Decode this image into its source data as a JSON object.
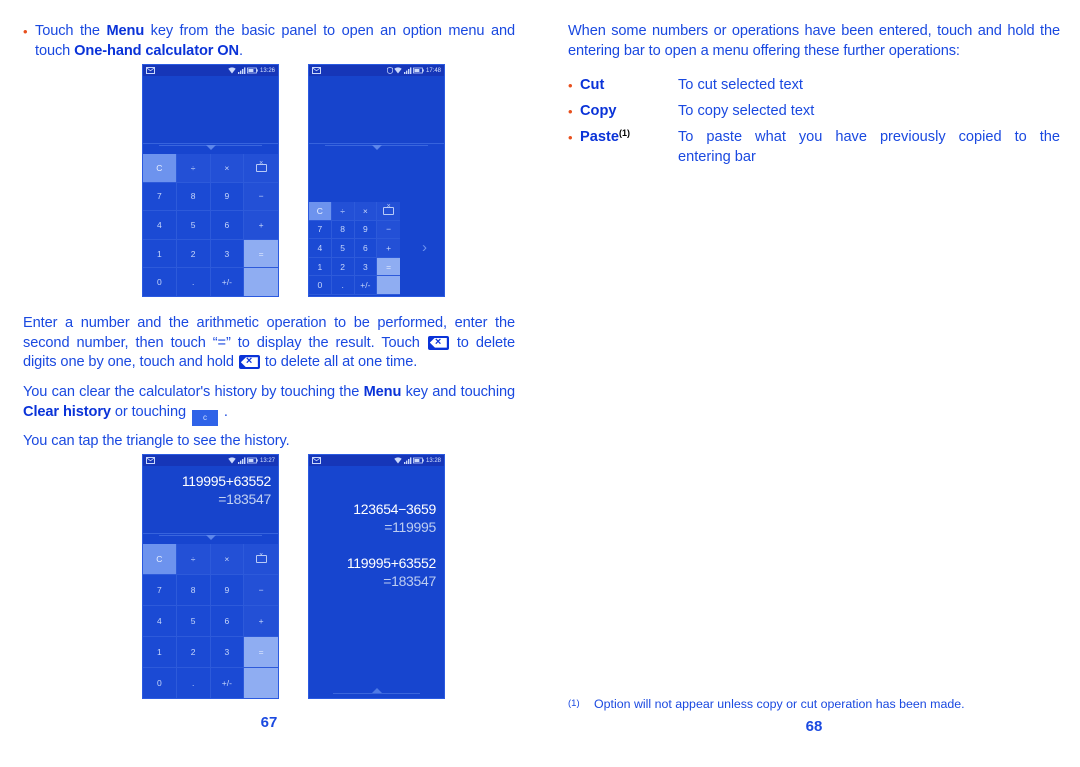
{
  "left_column": {
    "intro_bullet": {
      "bullet": "•",
      "segments": [
        {
          "t": "Touch the ",
          "b": false
        },
        {
          "t": "Menu",
          "b": true
        },
        {
          "t": " key from the basic panel to open an option menu and touch ",
          "b": false
        },
        {
          "t": "One-hand calculator ON",
          "b": true
        },
        {
          "t": ".",
          "b": false
        }
      ]
    },
    "para_enter": {
      "part1": "Enter a number and the arithmetic operation to be performed, enter the second number, then touch “=” to display the result. Touch ",
      "part2": " to delete digits one by one, touch and hold ",
      "part3": " to delete all at one time."
    },
    "para_clear": {
      "part1": "You can clear the calculator's history by touching the ",
      "menu": "Menu",
      "part2": " key and touching ",
      "clear_history": "Clear history",
      "part3": " or touching ",
      "key_c_label": "c",
      "part4": " ."
    },
    "para_triangle": "You can tap the triangle to see the history.",
    "page_number": "67"
  },
  "right_column": {
    "para_when": "When some numbers or operations have been entered, touch and hold the entering bar to open a menu offering these further operations:",
    "operations": [
      {
        "bullet": "•",
        "term": "Cut",
        "sup": "",
        "desc_lines": [
          "To cut selected text"
        ]
      },
      {
        "bullet": "•",
        "term": "Copy",
        "sup": "",
        "desc_lines": [
          "To copy selected text"
        ]
      },
      {
        "bullet": "•",
        "term": "Paste",
        "sup": "(1)",
        "desc_lines": [
          "To paste what you have previously copied to the",
          "entering bar"
        ]
      }
    ],
    "footnote": {
      "mark": "(1)",
      "text": "Option will not appear unless copy or cut operation has been made."
    },
    "page_number": "68"
  },
  "phones": {
    "phone1": {
      "statusbar": {
        "time": "13:26",
        "left_icon": "message-icon",
        "right_icons": [
          "wifi-icon",
          "signal-icon",
          "battery-icon"
        ]
      },
      "display": {
        "expression": "",
        "result": ""
      },
      "keypad": {
        "rows": [
          [
            {
              "l": "C",
              "s": "lite"
            },
            {
              "l": "÷",
              "s": "op"
            },
            {
              "l": "×",
              "s": "op"
            },
            {
              "l": "del",
              "s": "op"
            }
          ],
          [
            {
              "l": "7",
              "s": ""
            },
            {
              "l": "8",
              "s": ""
            },
            {
              "l": "9",
              "s": ""
            },
            {
              "l": "−",
              "s": "op"
            }
          ],
          [
            {
              "l": "4",
              "s": ""
            },
            {
              "l": "5",
              "s": ""
            },
            {
              "l": "6",
              "s": ""
            },
            {
              "l": "+",
              "s": "op"
            }
          ],
          [
            {
              "l": "1",
              "s": ""
            },
            {
              "l": "2",
              "s": ""
            },
            {
              "l": "3",
              "s": ""
            },
            {
              "l": "=",
              "s": "eq"
            }
          ],
          [
            {
              "l": "0",
              "s": ""
            },
            {
              "l": ".",
              "s": ""
            },
            {
              "l": "+/-",
              "s": ""
            },
            {
              "l": "",
              "s": "eq"
            }
          ]
        ]
      }
    },
    "phone2": {
      "statusbar": {
        "time": "17:48",
        "left_icon": "message-icon",
        "right_icons": [
          "shield-icon",
          "wifi-icon",
          "signal-icon",
          "battery-icon"
        ]
      },
      "display": {
        "expression": "",
        "result": ""
      },
      "expand_arrow": "›",
      "keypad": {
        "rows": [
          [
            {
              "l": "C",
              "s": "lite"
            },
            {
              "l": "÷",
              "s": "op"
            },
            {
              "l": "×",
              "s": "op"
            },
            {
              "l": "del",
              "s": "op"
            }
          ],
          [
            {
              "l": "7",
              "s": ""
            },
            {
              "l": "8",
              "s": ""
            },
            {
              "l": "9",
              "s": ""
            },
            {
              "l": "−",
              "s": "op"
            }
          ],
          [
            {
              "l": "4",
              "s": ""
            },
            {
              "l": "5",
              "s": ""
            },
            {
              "l": "6",
              "s": ""
            },
            {
              "l": "+",
              "s": "op"
            }
          ],
          [
            {
              "l": "1",
              "s": ""
            },
            {
              "l": "2",
              "s": ""
            },
            {
              "l": "3",
              "s": ""
            },
            {
              "l": "=",
              "s": "eq"
            }
          ],
          [
            {
              "l": "0",
              "s": ""
            },
            {
              "l": ".",
              "s": ""
            },
            {
              "l": "+/-",
              "s": ""
            },
            {
              "l": "",
              "s": "eq"
            }
          ]
        ]
      }
    },
    "phone3": {
      "statusbar": {
        "time": "13:27",
        "left_icon": "message-icon",
        "right_icons": [
          "wifi-icon",
          "signal-icon",
          "battery-icon"
        ]
      },
      "display": {
        "expression": "119995+63552",
        "result": "=183547"
      },
      "keypad": {
        "rows": [
          [
            {
              "l": "C",
              "s": "lite"
            },
            {
              "l": "÷",
              "s": "op"
            },
            {
              "l": "×",
              "s": "op"
            },
            {
              "l": "del",
              "s": "op"
            }
          ],
          [
            {
              "l": "7",
              "s": ""
            },
            {
              "l": "8",
              "s": ""
            },
            {
              "l": "9",
              "s": ""
            },
            {
              "l": "−",
              "s": "op"
            }
          ],
          [
            {
              "l": "4",
              "s": ""
            },
            {
              "l": "5",
              "s": ""
            },
            {
              "l": "6",
              "s": ""
            },
            {
              "l": "+",
              "s": "op"
            }
          ],
          [
            {
              "l": "1",
              "s": ""
            },
            {
              "l": "2",
              "s": ""
            },
            {
              "l": "3",
              "s": ""
            },
            {
              "l": "=",
              "s": "eq"
            }
          ],
          [
            {
              "l": "0",
              "s": ""
            },
            {
              "l": ".",
              "s": ""
            },
            {
              "l": "+/-",
              "s": ""
            },
            {
              "l": "",
              "s": "eq"
            }
          ]
        ]
      }
    },
    "phone4": {
      "statusbar": {
        "time": "13:28",
        "left_icon": "message-icon",
        "right_icons": [
          "wifi-icon",
          "signal-icon",
          "battery-icon"
        ]
      },
      "history": [
        {
          "expression": "123654−3659",
          "result": "=119995"
        },
        {
          "expression": "119995+63552",
          "result": "=183547"
        }
      ]
    }
  }
}
